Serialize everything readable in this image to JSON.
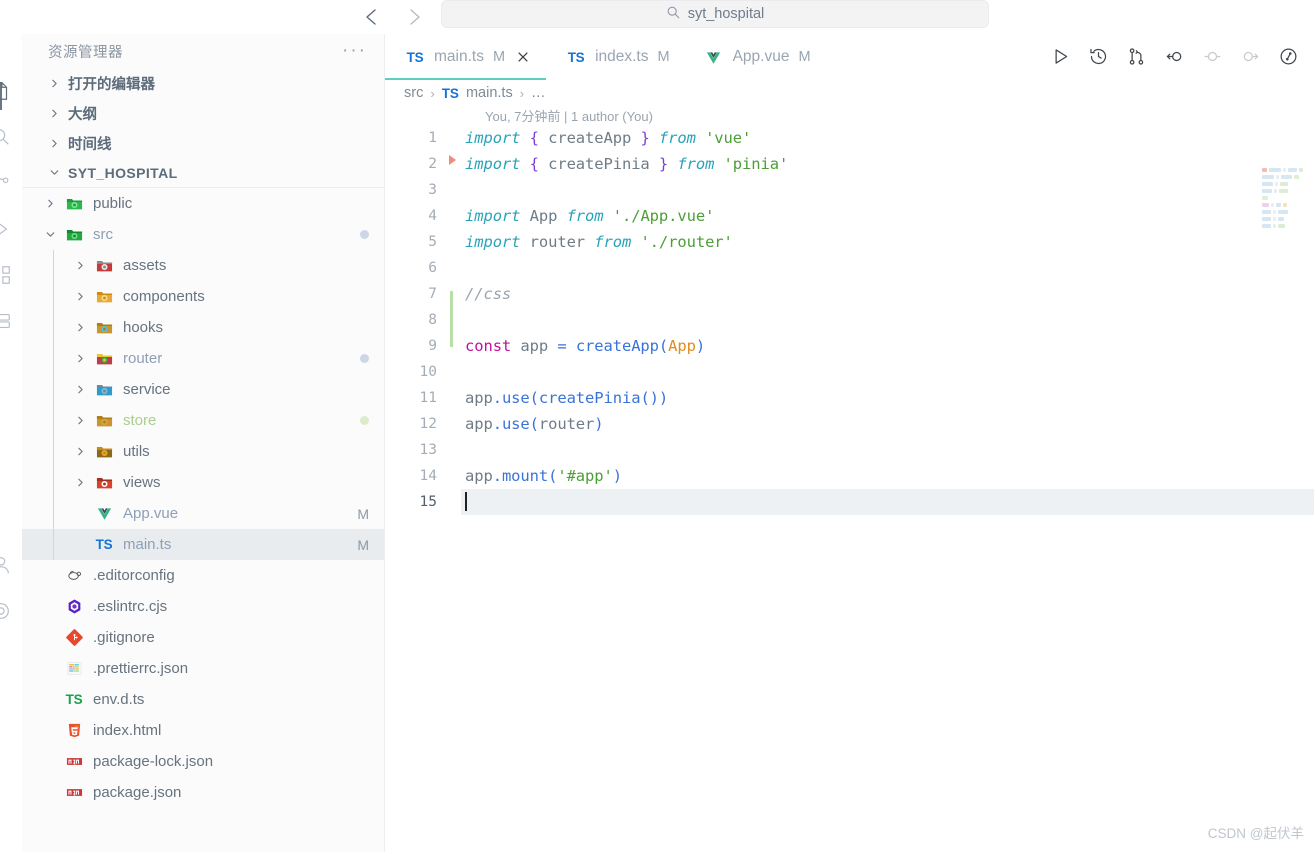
{
  "titlebar": {
    "back_icon": "arrow-left-icon",
    "forward_icon": "arrow-right-icon",
    "search_icon": "search-icon",
    "command_center_text": "syt_hospital"
  },
  "activitybar": {
    "items": [
      {
        "name": "explorer",
        "icon": "files-icon"
      },
      {
        "name": "search",
        "icon": "search-icon"
      },
      {
        "name": "source-control",
        "icon": "source-control-icon"
      },
      {
        "name": "run-debug",
        "icon": "run-debug-icon"
      },
      {
        "name": "extensions",
        "icon": "extensions-icon"
      },
      {
        "name": "remote",
        "icon": "remote-icon"
      },
      {
        "name": "accounts",
        "icon": "account-icon"
      },
      {
        "name": "settings",
        "icon": "gear-icon"
      }
    ]
  },
  "sidebar": {
    "title": "资源管理器",
    "more_actions": "···",
    "sections": [
      {
        "label": "打开的编辑器",
        "expanded": false
      },
      {
        "label": "大纲",
        "expanded": false
      },
      {
        "label": "时间线",
        "expanded": false
      }
    ],
    "root": {
      "label": "SYT_HOSPITAL",
      "expanded": true
    },
    "tree": [
      {
        "label": "public",
        "type": "folder",
        "icon": "folder-public-icon",
        "depth": 1,
        "expanded": false,
        "color": "#67737f",
        "badge": "",
        "dot": ""
      },
      {
        "label": "src",
        "type": "folder",
        "icon": "folder-src-icon",
        "depth": 1,
        "expanded": true,
        "color": "#8e9fb5",
        "badge": "",
        "dot": "#ccd6e6"
      },
      {
        "label": "assets",
        "type": "folder",
        "icon": "folder-assets-icon",
        "depth": 2,
        "expanded": false,
        "color": "#67737f",
        "badge": "",
        "dot": ""
      },
      {
        "label": "components",
        "type": "folder",
        "icon": "folder-components-icon",
        "depth": 2,
        "expanded": false,
        "color": "#67737f",
        "badge": "",
        "dot": ""
      },
      {
        "label": "hooks",
        "type": "folder",
        "icon": "folder-hooks-icon",
        "depth": 2,
        "expanded": false,
        "color": "#67737f",
        "badge": "",
        "dot": ""
      },
      {
        "label": "router",
        "type": "folder",
        "icon": "folder-router-icon",
        "depth": 2,
        "expanded": false,
        "color": "#8e9fb5",
        "badge": "",
        "dot": "#ccd6e6"
      },
      {
        "label": "service",
        "type": "folder",
        "icon": "folder-service-icon",
        "depth": 2,
        "expanded": false,
        "color": "#67737f",
        "badge": "",
        "dot": ""
      },
      {
        "label": "store",
        "type": "folder",
        "icon": "folder-store-icon",
        "depth": 2,
        "expanded": false,
        "color": "#a9cf8f",
        "badge": "",
        "dot": "#dcecc9"
      },
      {
        "label": "utils",
        "type": "folder",
        "icon": "folder-utils-icon",
        "depth": 2,
        "expanded": false,
        "color": "#67737f",
        "badge": "",
        "dot": ""
      },
      {
        "label": "views",
        "type": "folder",
        "icon": "folder-views-icon",
        "depth": 2,
        "expanded": false,
        "color": "#67737f",
        "badge": "",
        "dot": ""
      },
      {
        "label": "App.vue",
        "type": "file",
        "icon": "vue-icon",
        "depth": 2,
        "expanded": null,
        "color": "#8e9fb5",
        "badge": "M",
        "dot": ""
      },
      {
        "label": "main.ts",
        "type": "file",
        "icon": "typescript-icon",
        "depth": 2,
        "expanded": null,
        "color": "#8e9fb5",
        "badge": "M",
        "dot": "",
        "selected": true
      },
      {
        "label": ".editorconfig",
        "type": "file",
        "icon": "editorconfig-icon",
        "depth": 1,
        "expanded": null,
        "color": "#67737f",
        "badge": "",
        "dot": ""
      },
      {
        "label": ".eslintrc.cjs",
        "type": "file",
        "icon": "eslint-icon",
        "depth": 1,
        "expanded": null,
        "color": "#67737f",
        "badge": "",
        "dot": ""
      },
      {
        "label": ".gitignore",
        "type": "file",
        "icon": "git-icon",
        "depth": 1,
        "expanded": null,
        "color": "#67737f",
        "badge": "",
        "dot": ""
      },
      {
        "label": ".prettierrc.json",
        "type": "file",
        "icon": "prettier-icon",
        "depth": 1,
        "expanded": null,
        "color": "#67737f",
        "badge": "",
        "dot": ""
      },
      {
        "label": "env.d.ts",
        "type": "file",
        "icon": "typescript-def-icon",
        "depth": 1,
        "expanded": null,
        "color": "#67737f",
        "badge": "",
        "dot": ""
      },
      {
        "label": "index.html",
        "type": "file",
        "icon": "html5-icon",
        "depth": 1,
        "expanded": null,
        "color": "#67737f",
        "badge": "",
        "dot": ""
      },
      {
        "label": "package-lock.json",
        "type": "file",
        "icon": "npm-icon",
        "depth": 1,
        "expanded": null,
        "color": "#67737f",
        "badge": "",
        "dot": ""
      },
      {
        "label": "package.json",
        "type": "file",
        "icon": "npm-icon",
        "depth": 1,
        "expanded": null,
        "color": "#67737f",
        "badge": "",
        "dot": ""
      }
    ]
  },
  "editor": {
    "tabs": [
      {
        "label": "main.ts",
        "icon": "typescript-icon",
        "dirty": "M",
        "active": true,
        "closable": true
      },
      {
        "label": "index.ts",
        "icon": "typescript-icon",
        "dirty": "M",
        "active": false,
        "closable": false
      },
      {
        "label": "App.vue",
        "icon": "vue-icon",
        "dirty": "M",
        "active": false,
        "closable": false
      }
    ],
    "close_icon": "close-icon",
    "actions": [
      {
        "name": "run-play-icon",
        "dim": false
      },
      {
        "name": "history-icon",
        "dim": false
      },
      {
        "name": "source-control-icon",
        "dim": false
      },
      {
        "name": "step-back-icon",
        "dim": false
      },
      {
        "name": "step-over-icon",
        "dim": true
      },
      {
        "name": "step-forward-icon",
        "dim": true
      },
      {
        "name": "debug-alt-icon",
        "dim": false
      }
    ],
    "breadcrumb": [
      {
        "label": "src",
        "icon": ""
      },
      {
        "label": "main.ts",
        "icon": "typescript-icon"
      },
      {
        "label": "…",
        "icon": ""
      }
    ],
    "breadcrumb_separator": "›",
    "blame": "You, 7分钟前 | 1 author (You)",
    "active_line": 15,
    "lines": [
      {
        "num": 1,
        "change": false,
        "breakpoint": false,
        "tokens": [
          {
            "t": "import",
            "c": "k-kw"
          },
          {
            "t": " ",
            "c": "k-punct"
          },
          {
            "t": "{",
            "c": "k-brace"
          },
          {
            "t": " ",
            "c": "k-punct"
          },
          {
            "t": "createApp",
            "c": "k-id"
          },
          {
            "t": " ",
            "c": "k-punct"
          },
          {
            "t": "}",
            "c": "k-brace"
          },
          {
            "t": " ",
            "c": "k-punct"
          },
          {
            "t": "from",
            "c": "k-kw"
          },
          {
            "t": " ",
            "c": "k-punct"
          },
          {
            "t": "'vue'",
            "c": "k-str"
          }
        ]
      },
      {
        "num": 2,
        "change": false,
        "breakpoint": true,
        "tokens": [
          {
            "t": "import",
            "c": "k-kw"
          },
          {
            "t": " ",
            "c": "k-punct"
          },
          {
            "t": "{",
            "c": "k-brace"
          },
          {
            "t": " ",
            "c": "k-punct"
          },
          {
            "t": "createPinia",
            "c": "k-id"
          },
          {
            "t": " ",
            "c": "k-punct"
          },
          {
            "t": "}",
            "c": "k-brace"
          },
          {
            "t": " ",
            "c": "k-punct"
          },
          {
            "t": "from",
            "c": "k-kw"
          },
          {
            "t": " ",
            "c": "k-punct"
          },
          {
            "t": "'pinia'",
            "c": "k-str"
          }
        ]
      },
      {
        "num": 3,
        "change": false,
        "breakpoint": false,
        "tokens": []
      },
      {
        "num": 4,
        "change": false,
        "breakpoint": false,
        "tokens": [
          {
            "t": "import",
            "c": "k-kw"
          },
          {
            "t": " ",
            "c": "k-punct"
          },
          {
            "t": "App",
            "c": "k-id"
          },
          {
            "t": " ",
            "c": "k-punct"
          },
          {
            "t": "from",
            "c": "k-kw"
          },
          {
            "t": " ",
            "c": "k-punct"
          },
          {
            "t": "'./App.vue'",
            "c": "k-str"
          }
        ]
      },
      {
        "num": 5,
        "change": false,
        "breakpoint": false,
        "tokens": [
          {
            "t": "import",
            "c": "k-kw"
          },
          {
            "t": " ",
            "c": "k-punct"
          },
          {
            "t": "router",
            "c": "k-id"
          },
          {
            "t": " ",
            "c": "k-punct"
          },
          {
            "t": "from",
            "c": "k-kw"
          },
          {
            "t": " ",
            "c": "k-punct"
          },
          {
            "t": "'./router'",
            "c": "k-str"
          }
        ]
      },
      {
        "num": 6,
        "change": false,
        "breakpoint": false,
        "tokens": []
      },
      {
        "num": 7,
        "change": true,
        "breakpoint": false,
        "tokens": [
          {
            "t": "//css",
            "c": "k-com"
          }
        ]
      },
      {
        "num": 8,
        "change": true,
        "breakpoint": false,
        "tokens": []
      },
      {
        "num": 9,
        "change": false,
        "breakpoint": false,
        "tokens": [
          {
            "t": "const",
            "c": "k-kw2"
          },
          {
            "t": " ",
            "c": "k-punct"
          },
          {
            "t": "app",
            "c": "k-id"
          },
          {
            "t": " ",
            "c": "k-punct"
          },
          {
            "t": "=",
            "c": "k-fn"
          },
          {
            "t": " ",
            "c": "k-punct"
          },
          {
            "t": "createApp",
            "c": "k-fn"
          },
          {
            "t": "(",
            "c": "k-paren"
          },
          {
            "t": "App",
            "c": "k-type"
          },
          {
            "t": ")",
            "c": "k-paren"
          }
        ]
      },
      {
        "num": 10,
        "change": false,
        "breakpoint": false,
        "tokens": []
      },
      {
        "num": 11,
        "change": false,
        "breakpoint": false,
        "tokens": [
          {
            "t": "app",
            "c": "k-id"
          },
          {
            "t": ".",
            "c": "k-fn"
          },
          {
            "t": "use",
            "c": "k-fn"
          },
          {
            "t": "(",
            "c": "k-paren"
          },
          {
            "t": "createPinia",
            "c": "k-fn"
          },
          {
            "t": "(",
            "c": "k-paren"
          },
          {
            "t": ")",
            "c": "k-paren"
          },
          {
            "t": ")",
            "c": "k-paren"
          }
        ]
      },
      {
        "num": 12,
        "change": false,
        "breakpoint": false,
        "tokens": [
          {
            "t": "app",
            "c": "k-id"
          },
          {
            "t": ".",
            "c": "k-fn"
          },
          {
            "t": "use",
            "c": "k-fn"
          },
          {
            "t": "(",
            "c": "k-paren"
          },
          {
            "t": "router",
            "c": "k-id"
          },
          {
            "t": ")",
            "c": "k-paren"
          }
        ]
      },
      {
        "num": 13,
        "change": false,
        "breakpoint": false,
        "tokens": []
      },
      {
        "num": 14,
        "change": false,
        "breakpoint": false,
        "tokens": [
          {
            "t": "app",
            "c": "k-id"
          },
          {
            "t": ".",
            "c": "k-fn"
          },
          {
            "t": "mount",
            "c": "k-fn"
          },
          {
            "t": "(",
            "c": "k-paren"
          },
          {
            "t": "'#app'",
            "c": "k-str"
          },
          {
            "t": ")",
            "c": "k-paren"
          }
        ]
      },
      {
        "num": 15,
        "change": false,
        "breakpoint": false,
        "tokens": [],
        "cursor": true
      }
    ],
    "minimap": [
      [
        {
          "w": 5,
          "c": "#f2a49a"
        },
        {
          "w": 12,
          "c": "#c9dff0"
        },
        {
          "w": 3,
          "c": "#e4e8ec"
        },
        {
          "w": 9,
          "c": "#c9dff0"
        },
        {
          "w": 4,
          "c": "#cfe8c4"
        }
      ],
      [
        {
          "w": 12,
          "c": "#c9dff0"
        },
        {
          "w": 3,
          "c": "#e4e8ec"
        },
        {
          "w": 11,
          "c": "#c9dff0"
        },
        {
          "w": 5,
          "c": "#cfe8c4"
        }
      ],
      [
        {
          "w": 11,
          "c": "#c9dff0"
        },
        {
          "w": 3,
          "c": "#e4e8ec"
        },
        {
          "w": 8,
          "c": "#cfe8c4"
        }
      ],
      [
        {
          "w": 10,
          "c": "#c9dff0"
        },
        {
          "w": 3,
          "c": "#e4e8ec"
        },
        {
          "w": 9,
          "c": "#cfe8c4"
        }
      ],
      [
        {
          "w": 6,
          "c": "#d6ecc9"
        }
      ],
      [
        {
          "w": 7,
          "c": "#e8c4e8"
        },
        {
          "w": 3,
          "c": "#e4e8ec"
        },
        {
          "w": 5,
          "c": "#c9dff0"
        },
        {
          "w": 4,
          "c": "#f0d9a8"
        }
      ],
      [
        {
          "w": 9,
          "c": "#c9dff0"
        },
        {
          "w": 3,
          "c": "#e4e8ec"
        },
        {
          "w": 10,
          "c": "#c9dff0"
        }
      ],
      [
        {
          "w": 9,
          "c": "#c9dff0"
        },
        {
          "w": 3,
          "c": "#e4e8ec"
        },
        {
          "w": 6,
          "c": "#c9dff0"
        }
      ],
      [
        {
          "w": 9,
          "c": "#c9dff0"
        },
        {
          "w": 3,
          "c": "#e4e8ec"
        },
        {
          "w": 7,
          "c": "#cfe8c4"
        }
      ]
    ]
  },
  "watermark": "CSDN @起伏羊"
}
